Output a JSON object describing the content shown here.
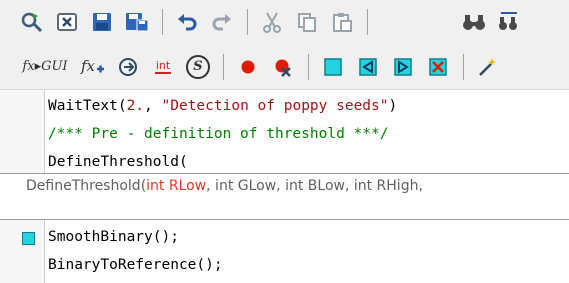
{
  "toolbar_top": {
    "items": [
      {
        "icon": "run-script-icon"
      },
      {
        "icon": "close-doc-icon"
      },
      {
        "icon": "save-icon"
      },
      {
        "icon": "save-all-icon"
      },
      {
        "separator": true
      },
      {
        "icon": "undo-icon"
      },
      {
        "icon": "redo-icon"
      },
      {
        "separator": true
      },
      {
        "icon": "cut-icon"
      },
      {
        "icon": "copy-icon"
      },
      {
        "icon": "paste-icon"
      },
      {
        "separator": true
      },
      {
        "icon": "find-icon"
      },
      {
        "icon": "find-replace-icon"
      }
    ]
  },
  "toolbar_bottom": {
    "fx_gui_label": "fx▸GUI",
    "int_label": "int",
    "s_label": "S"
  },
  "code": {
    "line1_fn": "WaitText(",
    "line1_num": "2.",
    "line1_sep": ", ",
    "line1_str": "\"Detection of poppy seeds\"",
    "line1_end": ")",
    "line2": "/*** Pre - definition of threshold ***/",
    "line3": "DefineThreshold(",
    "line4": "SmoothBinary();",
    "line5": "BinaryToReference();"
  },
  "tooltip": {
    "prefix": "DefineThreshold(",
    "param_active": "int RLow",
    "rest": ", int GLow, int BLow, int RHigh,"
  },
  "colors": {
    "string": "#a31515",
    "comment": "#008000",
    "active_param": "#e03a2a",
    "breakpoint": "#e21b00",
    "marker_cyan": "#22d3e0"
  }
}
